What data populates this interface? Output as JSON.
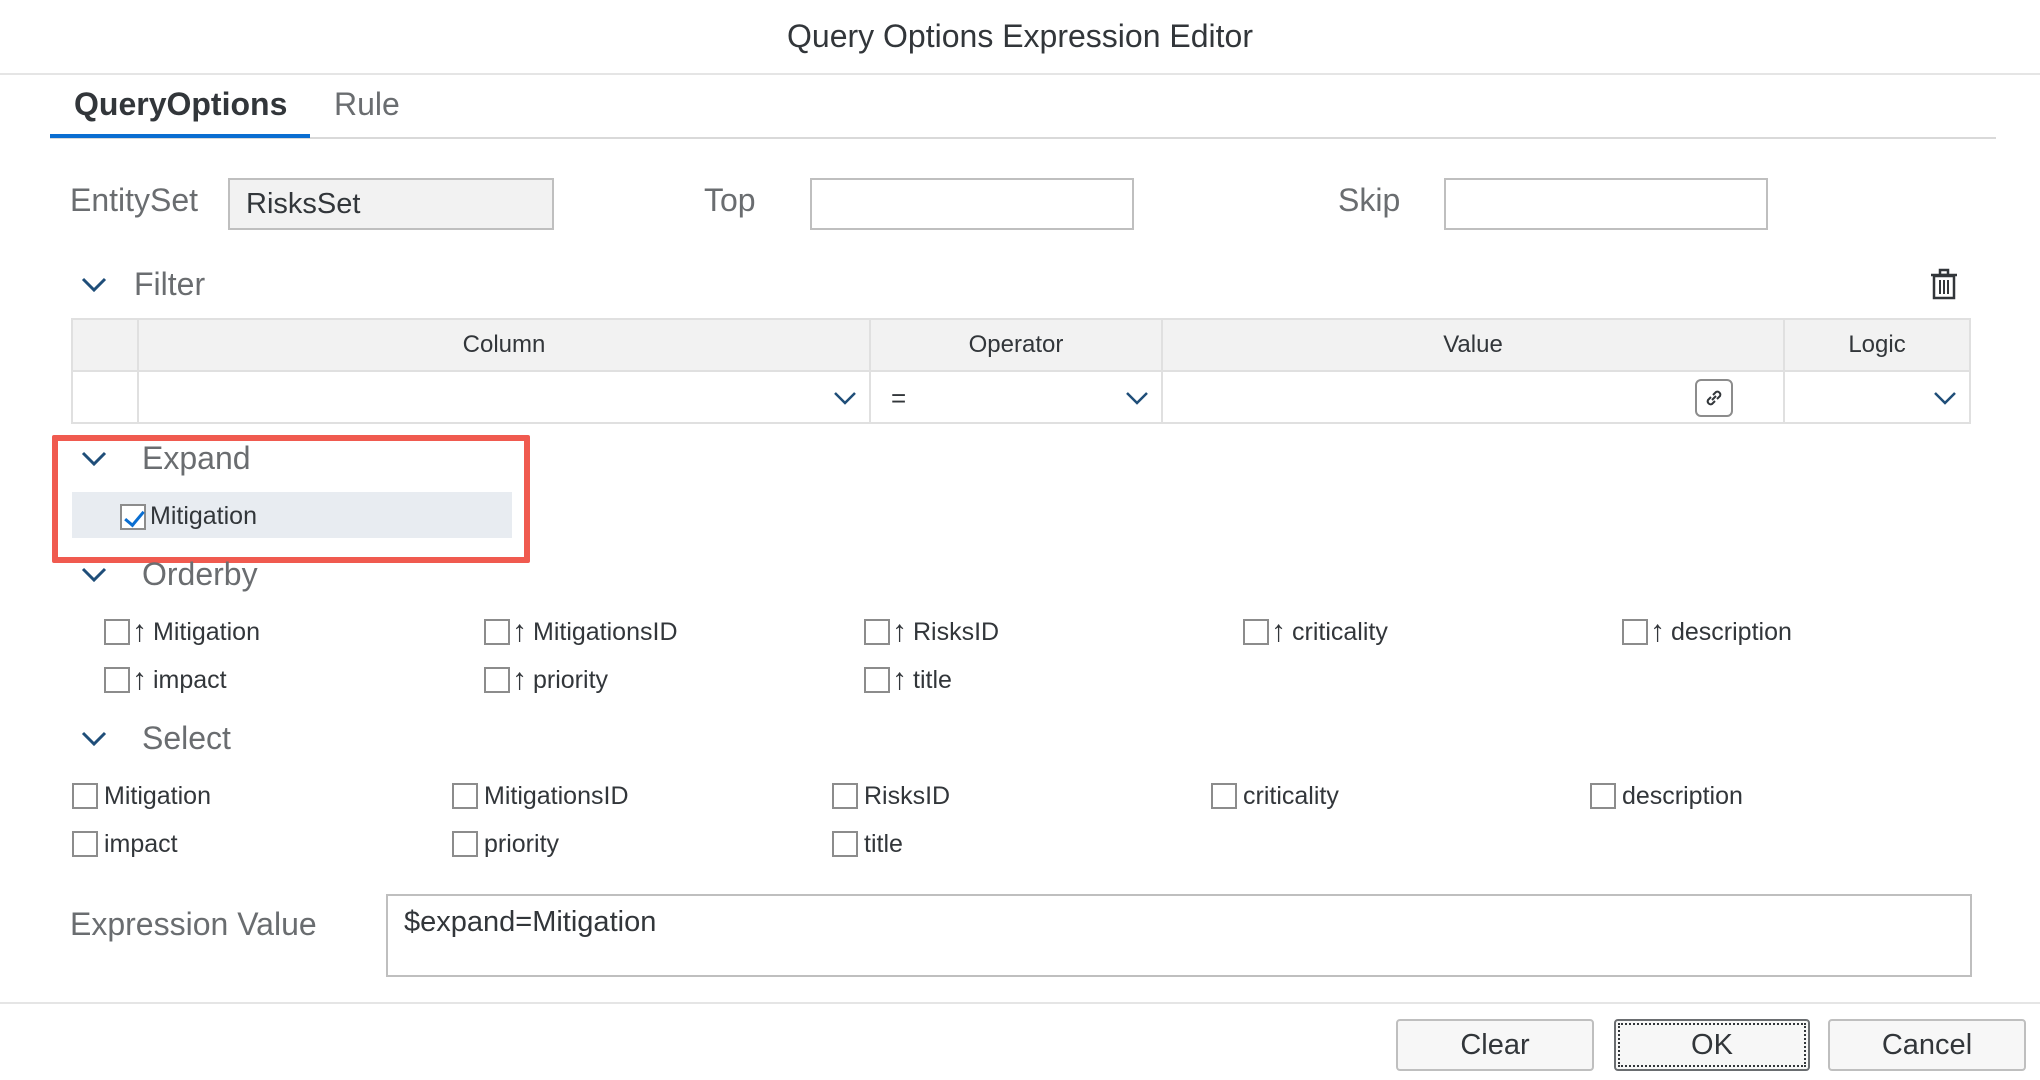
{
  "dialog": {
    "title": "Query Options Expression Editor"
  },
  "tabs": [
    {
      "label": "QueryOptions",
      "active": true
    },
    {
      "label": "Rule",
      "active": false
    }
  ],
  "fields": {
    "entityset": {
      "label": "EntitySet",
      "value": "RisksSet"
    },
    "top": {
      "label": "Top",
      "value": ""
    },
    "skip": {
      "label": "Skip",
      "value": ""
    }
  },
  "filter": {
    "title": "Filter",
    "columns": [
      "Column",
      "Operator",
      "Value",
      "Logic"
    ],
    "row": {
      "column": "",
      "operator": "=",
      "value": "",
      "logic": ""
    }
  },
  "expand": {
    "title": "Expand",
    "items": [
      {
        "label": "Mitigation",
        "checked": true
      }
    ]
  },
  "orderby": {
    "title": "Orderby",
    "items": [
      {
        "label": "Mitigation"
      },
      {
        "label": "MitigationsID"
      },
      {
        "label": "RisksID"
      },
      {
        "label": "criticality"
      },
      {
        "label": "description"
      },
      {
        "label": "impact"
      },
      {
        "label": "priority"
      },
      {
        "label": "title"
      }
    ]
  },
  "select": {
    "title": "Select",
    "items": [
      {
        "label": "Mitigation"
      },
      {
        "label": "MitigationsID"
      },
      {
        "label": "RisksID"
      },
      {
        "label": "criticality"
      },
      {
        "label": "description"
      },
      {
        "label": "impact"
      },
      {
        "label": "priority"
      },
      {
        "label": "title"
      }
    ]
  },
  "expression": {
    "label": "Expression Value",
    "value": "$expand=Mitigation"
  },
  "buttons": {
    "clear": "Clear",
    "ok": "OK",
    "cancel": "Cancel"
  },
  "colors": {
    "accent": "#0a6ed1",
    "highlight": "#f05a4f"
  }
}
